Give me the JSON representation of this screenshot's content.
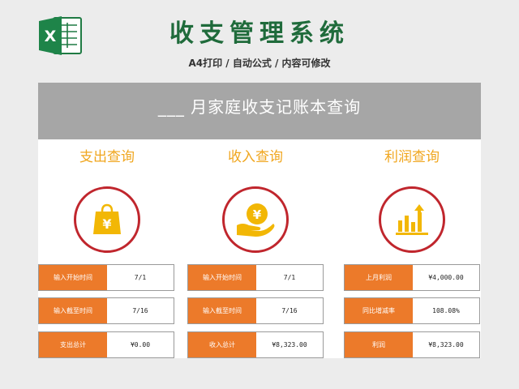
{
  "header": {
    "logo_icon": "excel-icon",
    "title": "收支管理系统",
    "subtitle": "A4打印 / 自动公式 / 内容可修改"
  },
  "banner": {
    "text": "___ 月家庭收支记账本查询"
  },
  "colors": {
    "accent_orange": "#ec7a2a",
    "title_gold": "#f0a61e",
    "circle_red": "#c0262d",
    "brand_green": "#1f6b3b",
    "banner_gray": "#a6a6a6"
  },
  "panels": [
    {
      "title": "支出查询",
      "icon": "shopping-bag-yuan-icon",
      "rows": [
        {
          "label": "输入开始时间",
          "value": "7/1"
        },
        {
          "label": "输入截至时间",
          "value": "7/16"
        },
        {
          "label": "支出总计",
          "value": "¥0.00"
        }
      ]
    },
    {
      "title": "收入查询",
      "icon": "hand-coin-yuan-icon",
      "rows": [
        {
          "label": "输入开始时间",
          "value": "7/1"
        },
        {
          "label": "输入截至时间",
          "value": "7/16"
        },
        {
          "label": "收入总计",
          "value": "¥8,323.00"
        }
      ]
    },
    {
      "title": "利润查询",
      "icon": "bar-chart-growth-icon",
      "rows": [
        {
          "label": "上月利润",
          "value": "¥4,000.00"
        },
        {
          "label": "同比增减率",
          "value": "108.08%"
        },
        {
          "label": "利润",
          "value": "¥8,323.00"
        }
      ]
    }
  ]
}
